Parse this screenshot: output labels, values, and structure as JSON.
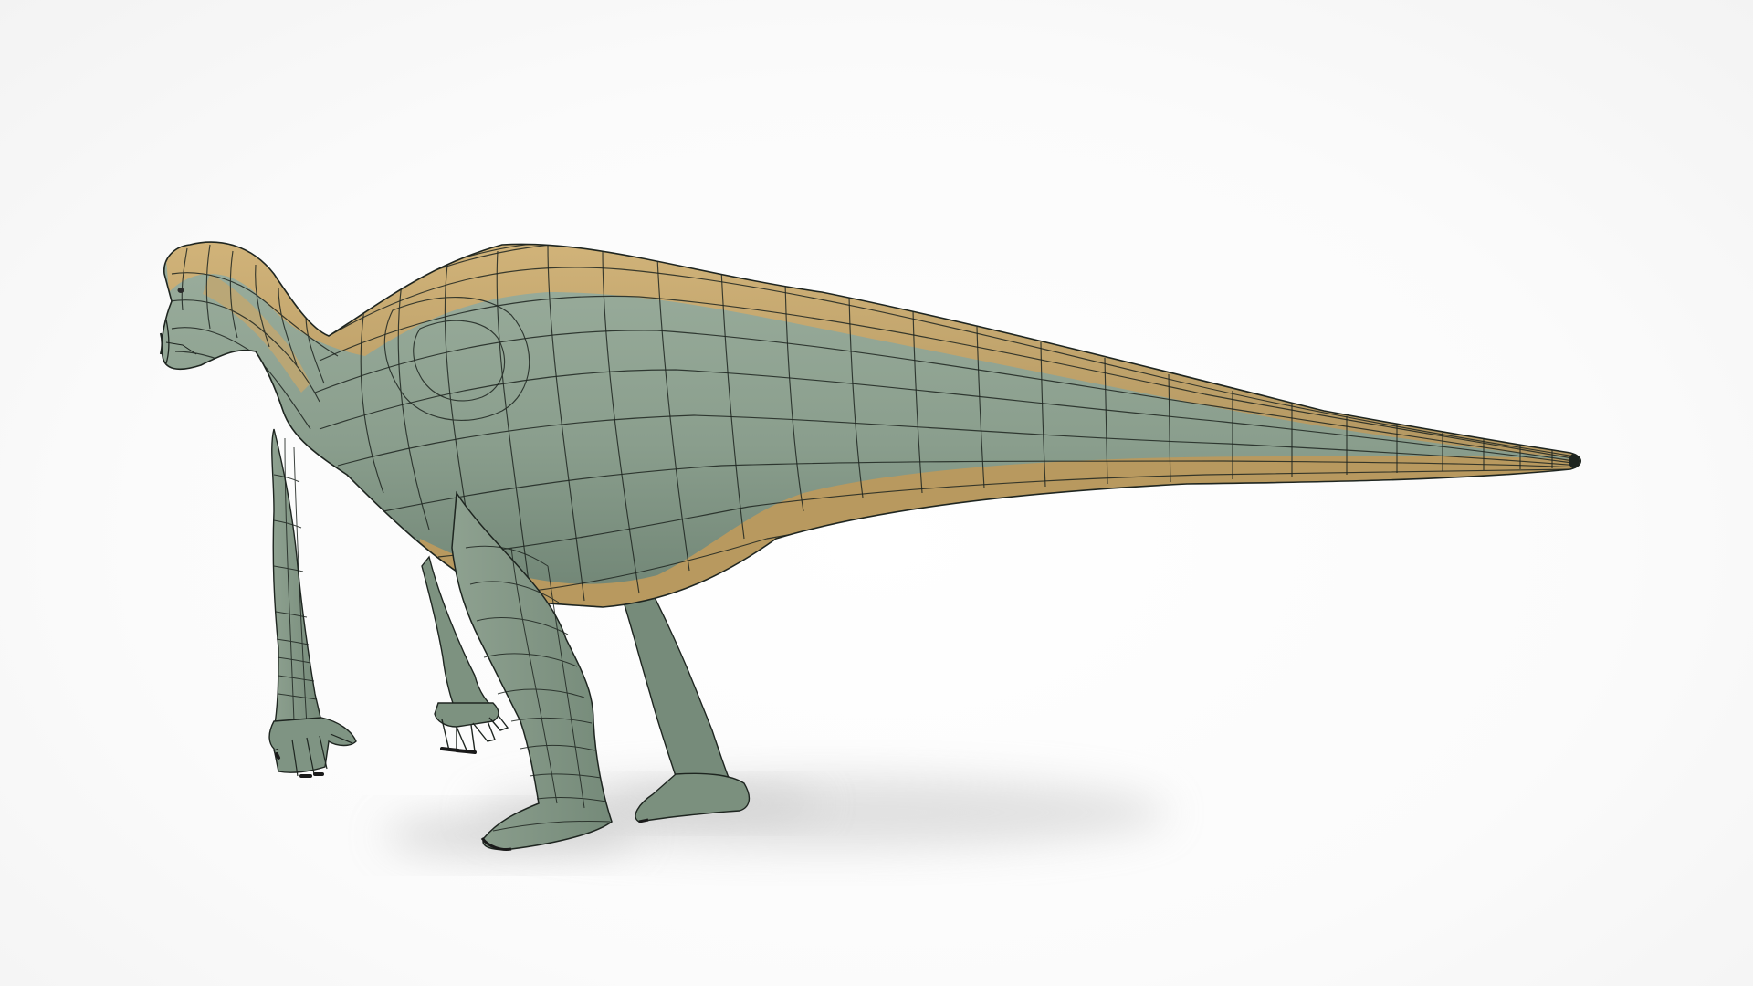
{
  "scene": {
    "subject": "dinosaur-wireframe-model",
    "colors": {
      "background": "#ffffff",
      "body": "#8fa392",
      "body_shade": "#758a7a",
      "stripe": "#c8aa72",
      "stripe_shade": "#a88e5c",
      "wire": "#1e2520",
      "shadow": "#c9c9c9",
      "claw": "#2a2a2a"
    }
  }
}
